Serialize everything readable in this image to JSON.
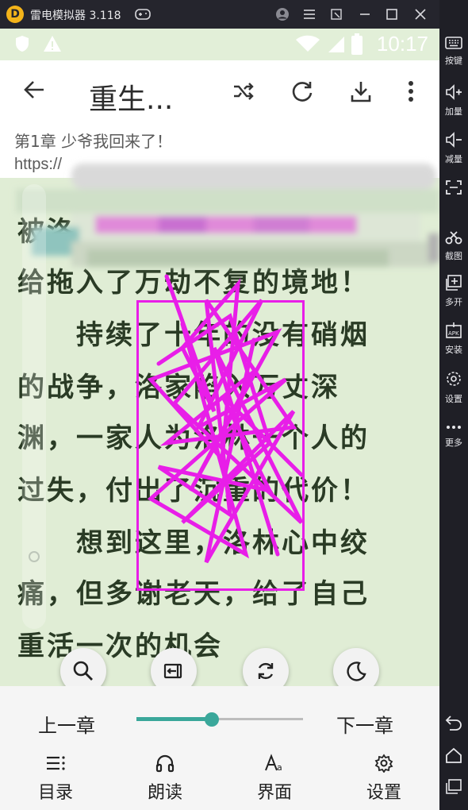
{
  "emulator": {
    "title": "雷电模拟器 3.118",
    "logo_letter": "D"
  },
  "status_bar": {
    "time": "10:17"
  },
  "app_bar": {
    "title": "重生..."
  },
  "chapter": {
    "title": "第1章 少爷我回来了！",
    "url": "https://"
  },
  "content": {
    "lines": [
      "被洛",
      "给拖入了万劫不复的境地！",
      "　　持续了十年的没有硝烟",
      "的战争，洛家陷入万丈深",
      "渊，一家人为洛林一个人的",
      "过失，付出了沉重的代价！",
      "　　想到这里，洛林心中绞",
      "痛，但多谢老天，给了自己",
      "重活一次的机会",
      "　　"
    ]
  },
  "fabs": {
    "search": "search-icon",
    "exit_fullscreen": "exit-icon",
    "auto_page": "auto-icon",
    "night": "moon-icon"
  },
  "chapter_nav": {
    "prev": "上一章",
    "next": "下一章",
    "progress": 0.45
  },
  "bottom_menu": [
    {
      "label": "目录",
      "icon": "list-icon"
    },
    {
      "label": "朗读",
      "icon": "headphones-icon"
    },
    {
      "label": "界面",
      "icon": "font-icon"
    },
    {
      "label": "设置",
      "icon": "gear-icon"
    }
  ],
  "sidebar": [
    {
      "label": "按键",
      "icon": "keyboard-icon"
    },
    {
      "label": "加量",
      "icon": "volume-up-icon"
    },
    {
      "label": "减量",
      "icon": "volume-down-icon"
    },
    {
      "label": "",
      "icon": "fullscreen-icon"
    },
    {
      "label": "截图",
      "icon": "scissors-icon"
    },
    {
      "label": "多开",
      "icon": "multi-instance-icon"
    },
    {
      "label": "安装",
      "icon": "apk-icon"
    },
    {
      "label": "设置",
      "icon": "settings-icon"
    },
    {
      "label": "更多",
      "icon": "more-icon"
    }
  ],
  "colors": {
    "accent": "#3aa79a",
    "page_bg": "#e0edd5",
    "scrawl": "#e81ee8"
  }
}
